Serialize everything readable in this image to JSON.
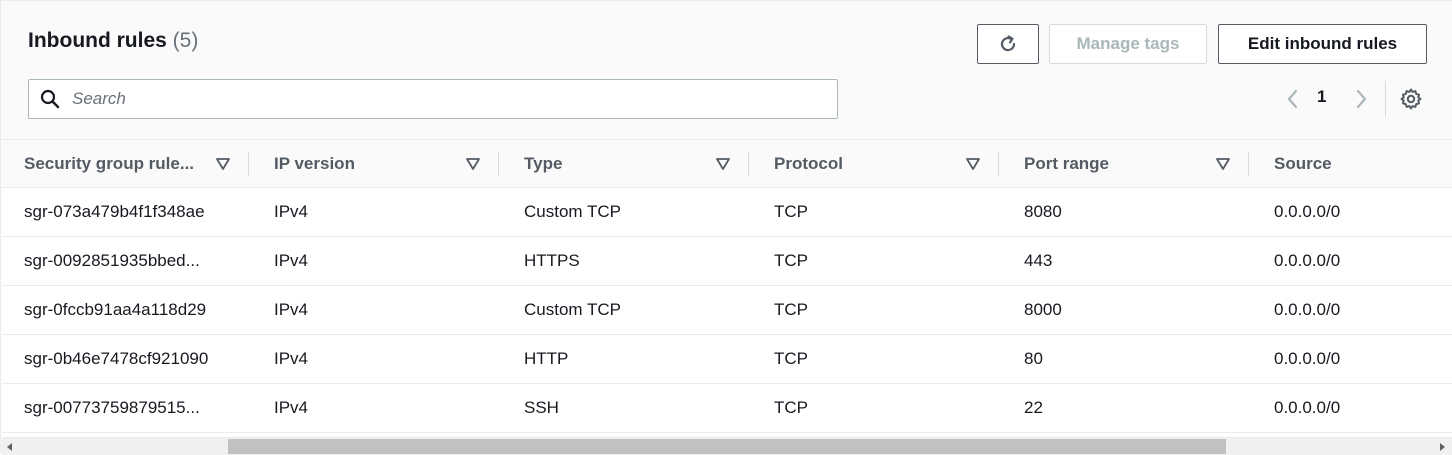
{
  "header": {
    "title": "Inbound rules",
    "count": "(5)",
    "refresh_icon": "refresh-icon",
    "manage_tags_label": "Manage tags",
    "edit_inbound_rules_label": "Edit inbound rules"
  },
  "search": {
    "placeholder": "Search",
    "value": "",
    "icon": "search-icon"
  },
  "pagination": {
    "current_page": "1",
    "prev_icon": "chevron-left-icon",
    "next_icon": "chevron-right-icon",
    "settings_icon": "gear-icon"
  },
  "table": {
    "columns": [
      "Security group rule...",
      "IP version",
      "Type",
      "Protocol",
      "Port range",
      "Source"
    ],
    "rows": [
      [
        "sgr-073a479b4f1f348ae",
        "IPv4",
        "Custom TCP",
        "TCP",
        "8080",
        "0.0.0.0/0"
      ],
      [
        "sgr-0092851935bbed...",
        "IPv4",
        "HTTPS",
        "TCP",
        "443",
        "0.0.0.0/0"
      ],
      [
        "sgr-0fccb91aa4a118d29",
        "IPv4",
        "Custom TCP",
        "TCP",
        "8000",
        "0.0.0.0/0"
      ],
      [
        "sgr-0b46e7478cf921090",
        "IPv4",
        "HTTP",
        "TCP",
        "80",
        "0.0.0.0/0"
      ],
      [
        "sgr-00773759879515...",
        "IPv4",
        "SSH",
        "TCP",
        "22",
        "0.0.0.0/0"
      ]
    ]
  },
  "colors": {
    "text_primary": "#16191f",
    "text_secondary": "#545b64",
    "text_disabled": "#aab7b8",
    "header_bg": "#fafafa",
    "border": "#eaeded"
  }
}
